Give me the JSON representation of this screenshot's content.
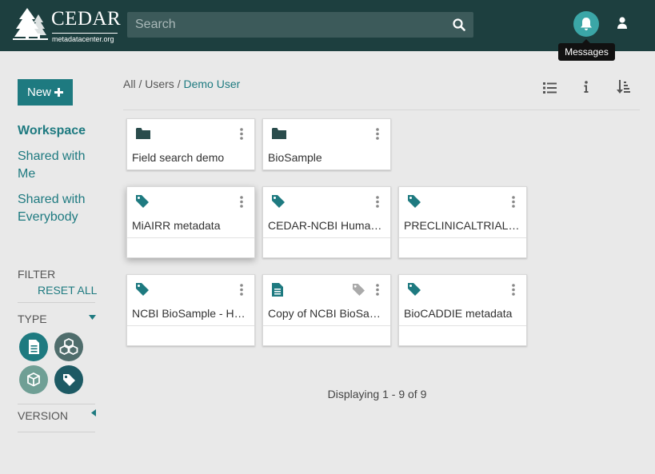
{
  "header": {
    "logo_text": "CEDAR",
    "logo_subtext": "metadatacenter.org",
    "search_placeholder": "Search",
    "tooltip": "Messages"
  },
  "sidebar": {
    "new_label": "New",
    "nav": [
      {
        "label": "Workspace",
        "active": true
      },
      {
        "label": "Shared with Me"
      },
      {
        "label": "Shared with Everybody"
      }
    ],
    "filter_label": "FILTER",
    "reset_label": "RESET ALL",
    "type_label": "TYPE",
    "version_label": "VERSION"
  },
  "breadcrumb": {
    "all": "All",
    "users": "Users",
    "current": "Demo User",
    "separator": "/"
  },
  "cards": [
    {
      "title": "Field search demo",
      "icon": "folder-icon"
    },
    {
      "title": "BioSample",
      "icon": "folder-icon"
    },
    {
      "title": "MiAIRR metadata",
      "icon": "tag-icon"
    },
    {
      "title": "CEDAR-NCBI Human Tissue",
      "icon": "tag-icon"
    },
    {
      "title": "PRECLINICALTRIALS.EU",
      "icon": "tag-icon"
    },
    {
      "title": "NCBI BioSample - Human",
      "icon": "tag-icon"
    },
    {
      "title": "Copy of NCBI BioSample",
      "icon": "document-icon"
    },
    {
      "title": "BioCADDIE metadata",
      "icon": "tag-icon"
    }
  ],
  "footer": {
    "display_count": "Displaying 1 - 9 of 9"
  },
  "colors": {
    "header": "#1d3f3f",
    "accent": "#1e7a80",
    "notification": "#3ba6a7"
  }
}
